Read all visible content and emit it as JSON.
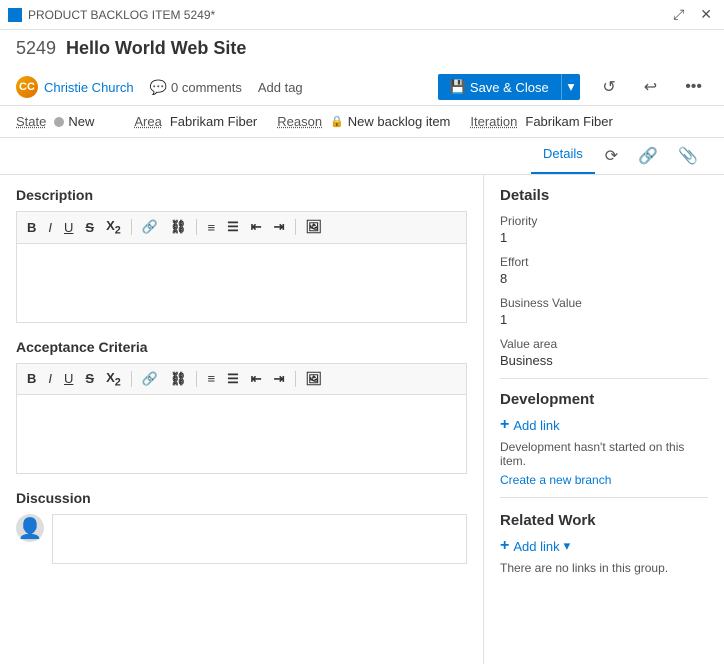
{
  "titleBar": {
    "icon": "■",
    "text": "PRODUCT BACKLOG ITEM 5249*",
    "expandBtn": "⤢",
    "closeBtn": "✕"
  },
  "header": {
    "itemId": "5249",
    "itemTitle": "Hello World Web Site"
  },
  "subHeader": {
    "userName": "Christie Church",
    "commentsCount": "0 comments",
    "addTagLabel": "Add tag",
    "saveCloseLabel": "Save & Close",
    "saveIcon": "💾"
  },
  "meta": {
    "stateLabel": "State",
    "stateValue": "New",
    "reasonLabel": "Reason",
    "reasonValue": "New backlog item",
    "areaLabel": "Area",
    "areaValue": "Fabrikam Fiber",
    "iterationLabel": "Iteration",
    "iterationValue": "Fabrikam Fiber"
  },
  "tabs": {
    "details": "Details",
    "historyIcon": "🕐",
    "linkIcon": "🔗",
    "attachIcon": "📎"
  },
  "leftPanel": {
    "descriptionLabel": "Description",
    "toolbar1": {
      "bold": "B",
      "italic": "I",
      "underline": "U",
      "strikethrough": "S̶",
      "sub": "X₂",
      "link": "🔗",
      "linkAlt": "⛓",
      "list1": "≡",
      "list2": "☰",
      "indent1": "⇤",
      "indent2": "⇥",
      "image": "🖼"
    },
    "acceptanceCriteriaLabel": "Acceptance Criteria",
    "discussionLabel": "Discussion"
  },
  "rightPanel": {
    "detailsTitle": "Details",
    "priorityLabel": "Priority",
    "priorityValue": "1",
    "effortLabel": "Effort",
    "effortValue": "8",
    "businessValueLabel": "Business Value",
    "businessValueValue": "1",
    "valueAreaLabel": "Value area",
    "valueAreaValue": "Business",
    "developmentTitle": "Development",
    "addLinkLabel": "Add link",
    "devNote": "Development hasn't started on this item.",
    "devLinkLabel": "Create a new branch",
    "relatedWorkTitle": "Related Work",
    "relatedAddLinkLabel": "Add link",
    "relatedNote": "There are no links in this group."
  }
}
